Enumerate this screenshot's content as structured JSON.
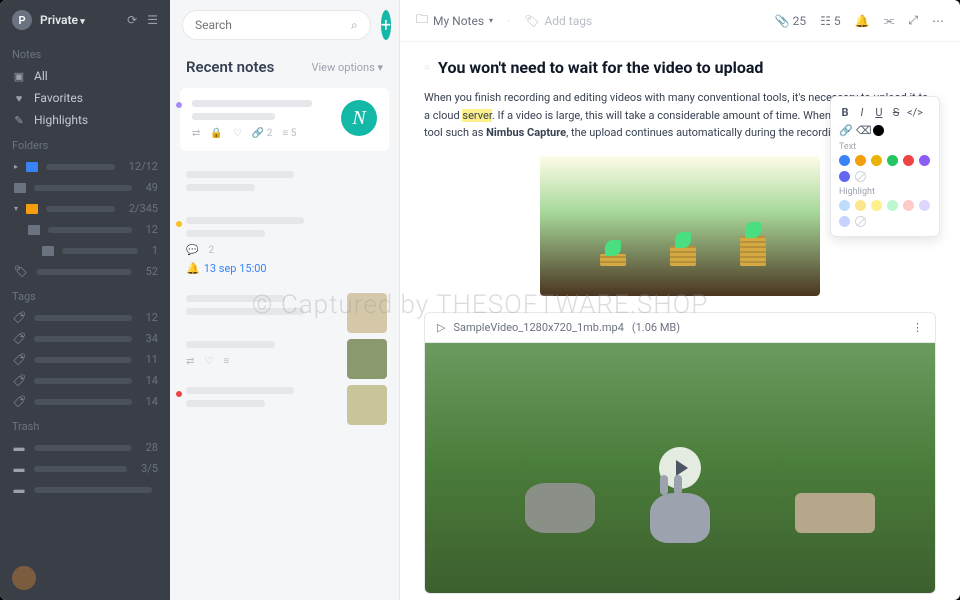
{
  "sidebar": {
    "avatar_letter": "P",
    "workspace": "Private",
    "sections": {
      "notes": "Notes",
      "folders": "Folders",
      "tags": "Tags",
      "trash": "Trash"
    },
    "nav": {
      "all": "All",
      "favorites": "Favorites",
      "highlights": "Highlights"
    },
    "folders": [
      {
        "color": "#3b82f6",
        "count": "12/12",
        "level": 1
      },
      {
        "color": "#6b7280",
        "count": "49",
        "level": 1
      },
      {
        "color": "#f59e0b",
        "count": "2/345",
        "level": 1,
        "expanded": true
      },
      {
        "color": "#6b7280",
        "count": "12",
        "level": 2
      },
      {
        "color": "#6b7280",
        "count": "1",
        "level": 3
      },
      {
        "color": "#6b7280",
        "count": "52",
        "level": 1,
        "tagged": true
      }
    ],
    "tags": [
      {
        "count": "12"
      },
      {
        "count": "34"
      },
      {
        "count": "11"
      },
      {
        "count": "14"
      },
      {
        "count": "14"
      }
    ],
    "trash": [
      {
        "count": "28"
      },
      {
        "count": "3/5"
      },
      {
        "count": ""
      }
    ]
  },
  "notelist": {
    "search_placeholder": "Search",
    "header": "Recent notes",
    "view_options": "View options ▾",
    "cards": [
      {
        "dot": "#a78bfa",
        "meta": [
          "⇄",
          "🔒",
          "♡",
          "🔗 2",
          "≡ 5"
        ],
        "avatar": "N"
      },
      {
        "dot": null
      },
      {
        "dot": "#fbbf24",
        "reminder": "13 sep 15:00",
        "meta_count": "2"
      },
      {
        "dot": null,
        "thumb": true
      },
      {
        "dot": null,
        "meta": [
          "⇄",
          "♡",
          "≡"
        ],
        "thumb": true
      },
      {
        "dot": "#ef4444",
        "thumb": true
      }
    ]
  },
  "topbar": {
    "breadcrumb": "My Notes",
    "add_tags": "Add tags",
    "attachments": "25",
    "todos": "5"
  },
  "note": {
    "title": "You won't need to wait for the video to upload",
    "body_p1_a": "When you finish recording and editing videos with many conventional tools, it's necessary to upload it to a cloud ",
    "body_p1_hl": "server",
    "body_p1_b": ". If a video is large, this will take a considerable amount of time. When you use a streaming tool such as ",
    "body_p1_bold": "Nimbus Capture",
    "body_p1_c": ", the upload continues automatically during the recording."
  },
  "video": {
    "filename": "SampleVideo_1280x720_1mb.mp4",
    "size": "(1.06 MB)"
  },
  "popover": {
    "text_label": "Text",
    "highlight_label": "Highlight",
    "text_colors": [
      "#3b82f6",
      "#f59e0b",
      "#eab308",
      "#22c55e",
      "#ef4444",
      "#8b5cf6",
      "#6366f1"
    ],
    "highlight_colors": [
      "#bfdbfe",
      "#fde68a",
      "#fef08a",
      "#bbf7d0",
      "#fecaca",
      "#ddd6fe",
      "#c7d2fe"
    ]
  },
  "watermark": "© Captured by THESOFTWARE.SHOP"
}
